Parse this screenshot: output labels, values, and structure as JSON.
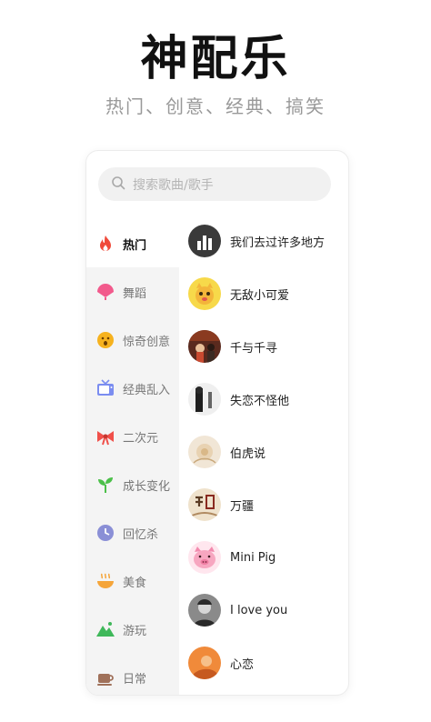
{
  "header": {
    "title": "神配乐",
    "tagline": "热门、创意、经典、搞笑"
  },
  "search": {
    "placeholder": "搜索歌曲/歌手",
    "icon": "search-icon"
  },
  "categories": [
    {
      "label": "热门",
      "icon": "flame-icon",
      "color": "#f04a3a",
      "active": true
    },
    {
      "label": "舞蹈",
      "icon": "fan-icon",
      "color": "#f25a8c"
    },
    {
      "label": "惊奇创意",
      "icon": "surprised-face-icon",
      "color": "#f6b21e"
    },
    {
      "label": "经典乱入",
      "icon": "tv-icon",
      "color": "#7b8df0"
    },
    {
      "label": "二次元",
      "icon": "bow-icon",
      "color": "#f0504a"
    },
    {
      "label": "成长变化",
      "icon": "sprout-icon",
      "color": "#4cc04a"
    },
    {
      "label": "回忆杀",
      "icon": "clock-icon",
      "color": "#8a8fd6"
    },
    {
      "label": "美食",
      "icon": "bowl-icon",
      "color": "#f5a53a"
    },
    {
      "label": "游玩",
      "icon": "mountain-icon",
      "color": "#3fb85a"
    },
    {
      "label": "日常",
      "icon": "coffee-cup-icon",
      "color": "#a0715a"
    }
  ],
  "songs": [
    {
      "title": "我们去过许多地方",
      "cover": "bars-cover"
    },
    {
      "title": "无敌小可爱",
      "cover": "cartoon-cover"
    },
    {
      "title": "千与千寻",
      "cover": "film-cover"
    },
    {
      "title": "失恋不怪他",
      "cover": "bw-cover"
    },
    {
      "title": "伯虎说",
      "cover": "flower-cover"
    },
    {
      "title": "万疆",
      "cover": "calligraphy-cover"
    },
    {
      "title": "Mini Pig",
      "cover": "pig-cover"
    },
    {
      "title": "I love you",
      "cover": "portrait-cover"
    },
    {
      "title": "心恋",
      "cover": "orange-cover"
    }
  ]
}
